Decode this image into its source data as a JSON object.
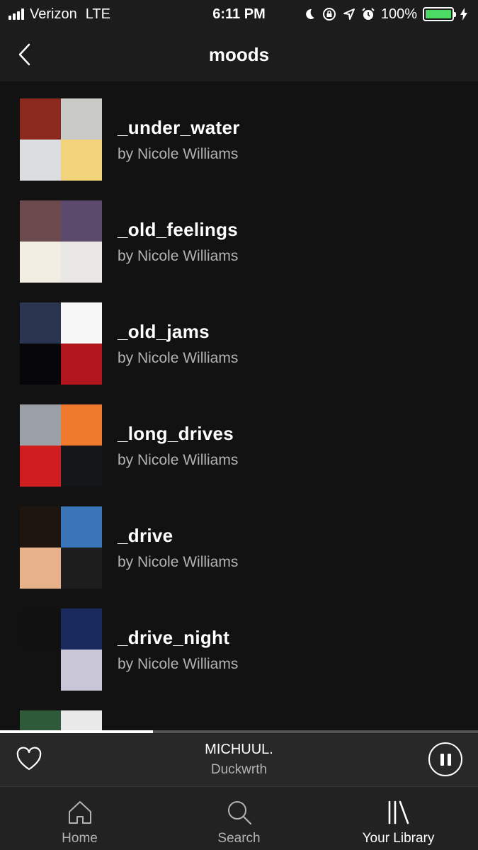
{
  "status_bar": {
    "carrier": "Verizon",
    "network": "LTE",
    "time": "6:11 PM",
    "battery": "100%",
    "battery_level": 1.0,
    "icons": [
      "signal-icon",
      "moon-icon",
      "rotation-lock-icon",
      "location-icon",
      "alarm-icon",
      "battery-icon",
      "charging-icon"
    ]
  },
  "header": {
    "title": "moods",
    "back_icon": "chevron-left-icon"
  },
  "playlists": [
    {
      "title": "_under_water",
      "subtitle": "by Nicole Williams",
      "cover_colors": [
        "#8a2a1e",
        "#c9c9c6",
        "#dcdde0",
        "#f2d27a"
      ]
    },
    {
      "title": "_old_feelings",
      "subtitle": "by Nicole Williams",
      "cover_colors": [
        "#6b4a4e",
        "#5b4a6b",
        "#f1ede2",
        "#e9e7e4"
      ]
    },
    {
      "title": "_old_jams",
      "subtitle": "by Nicole Williams",
      "cover_colors": [
        "#2b3550",
        "#f7f7f7",
        "#060608",
        "#b2161c"
      ]
    },
    {
      "title": "_long_drives",
      "subtitle": "by Nicole Williams",
      "cover_colors": [
        "#9aa0a6",
        "#ef7a2d",
        "#cf1d20",
        "#15161a"
      ]
    },
    {
      "title": "_drive",
      "subtitle": "by Nicole Williams",
      "cover_colors": [
        "#1f150f",
        "#3a75b8",
        "#e7b18a",
        "#1d1d1d"
      ]
    },
    {
      "title": "_drive_night",
      "subtitle": "by Nicole Williams",
      "cover_colors": [
        "#111111",
        "#1b2a5c",
        "#121212",
        "#c9c7d7"
      ]
    },
    {
      "title": "",
      "subtitle": "",
      "cover_colors": [
        "#2f5a3a",
        "#e9e9e9",
        "#1c1c1c",
        "#1c1c1c"
      ]
    }
  ],
  "now_playing": {
    "title": "MICHUUL.",
    "artist": "Duckwrth",
    "progress": 0.32
  },
  "tabs": [
    {
      "label": "Home",
      "icon": "home-icon",
      "active": false
    },
    {
      "label": "Search",
      "icon": "search-icon",
      "active": false
    },
    {
      "label": "Your Library",
      "icon": "library-icon",
      "active": true
    }
  ],
  "colors": {
    "background": "#121212",
    "bar": "#282828",
    "accent_battery": "#4cd964",
    "subtext": "#b3b3b3"
  }
}
